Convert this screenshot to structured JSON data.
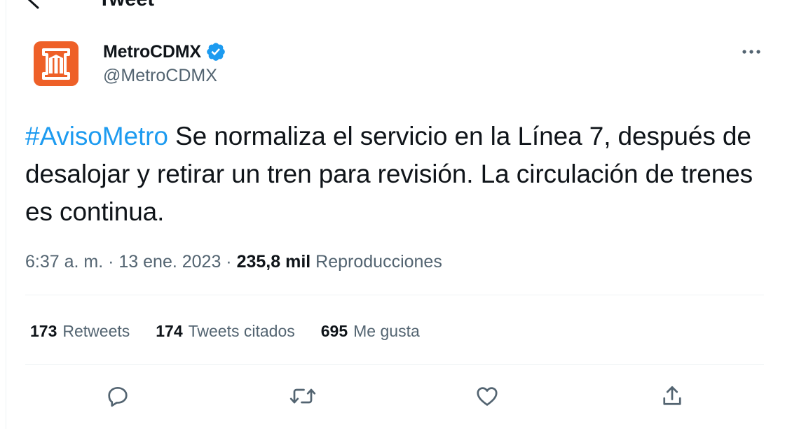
{
  "header": {
    "title": "Tweet",
    "back_icon": "arrow-left-icon"
  },
  "author": {
    "display_name": "MetroCDMX",
    "handle": "@MetroCDMX",
    "verified": true,
    "verified_color": "#1d9bf0",
    "avatar_color": "#ee6028",
    "avatar_icon": "metro-logo-icon"
  },
  "tweet": {
    "hashtag": "#AvisoMetro",
    "text": " Se normaliza el servicio en la Línea 7, después de desalojar y retirar un tren para revisión. La circulación de trenes es continua."
  },
  "meta": {
    "time_date": "6:37 a. m. · 13 ene. 2023 · ",
    "views_count": "235,8 mil",
    "views_label": " Reproducciones"
  },
  "stats": [
    {
      "count": "173",
      "label": "Retweets"
    },
    {
      "count": "174",
      "label": "Tweets citados"
    },
    {
      "count": "695",
      "label": "Me gusta"
    }
  ],
  "actions": [
    "reply-icon",
    "retweet-icon",
    "like-icon",
    "share-icon"
  ],
  "colors": {
    "accent": "#1d9bf0",
    "secondary_text": "#536471",
    "primary_text": "#0f1419",
    "divider": "#eff3f4"
  }
}
